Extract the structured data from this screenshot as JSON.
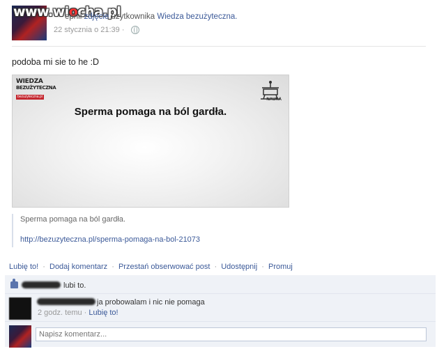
{
  "header": {
    "watermark": {
      "prefix": "www.wi",
      "accent": "o",
      "suffix": "cha.pl"
    },
    "share_text": "epnił",
    "share_link_photo": "zdjęcie",
    "share_text2": "użytkownika",
    "share_link_user": "Wiedza bezużyteczna.",
    "timestamp": "22 stycznia o 21:39",
    "separator": "·"
  },
  "status_text": "podoba mi sie to he :D",
  "photo": {
    "logo_line1": "WIEDZA",
    "logo_line2": "BEZUŻYTECZNA",
    "logo_line3": "bezuzyteczna.pl",
    "caption": "Sperma pomaga na ból gardła.",
    "corner_label": "NAUKA"
  },
  "preview": {
    "title": "Sperma pomaga na ból gardła.",
    "url": "http://bezuzyteczna.pl/sperma-pomaga-na-bol-21073"
  },
  "actions": {
    "like": "Lubię to!",
    "comment": "Dodaj komentarz",
    "unfollow": "Przestań obserwować post",
    "share": "Udostępnij",
    "promote": "Promuj",
    "separator": "·"
  },
  "likes": {
    "text": "lubi to."
  },
  "comment": {
    "text": "ja probowalam i nic nie pomaga",
    "time": "2 godz. temu",
    "separator": "·",
    "like": "Lubię to!"
  },
  "comment_input": {
    "placeholder": "Napisz komentarz..."
  },
  "colors": {
    "link": "#3b5998",
    "ufi_bg": "#eff2f7",
    "logo_red": "#c4262e"
  }
}
